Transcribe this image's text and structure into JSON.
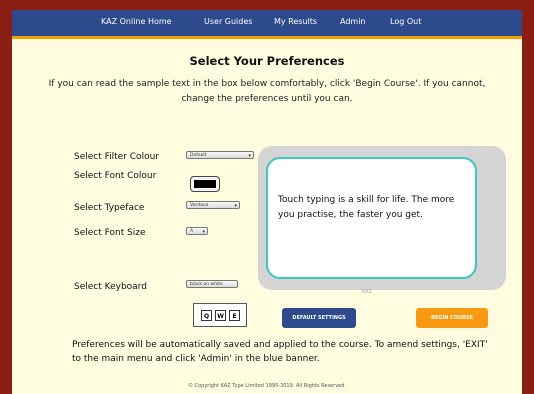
{
  "nav": {
    "items": [
      "KAZ Online Home",
      "User Guides",
      "My Results",
      "Admin",
      "Log Out"
    ]
  },
  "title": "Select Your Preferences",
  "intro": "If you can read the sample text in the box below comfortably, click 'Begin Course'. If you cannot, change the preferences until you can.",
  "labels": {
    "filter_colour": "Select Filter Colour",
    "font_colour": "Select Font Colour",
    "typeface": "Select Typeface",
    "font_size": "Select Font Size",
    "keyboard": "Select Keyboard"
  },
  "controls": {
    "filter_colour_value": "Default",
    "font_colour_value": "#000000",
    "typeface_value": "Verdana",
    "font_size_value": "A",
    "keyboard_value": "black on white"
  },
  "keyboard_keys": [
    "Q",
    "W",
    "E"
  ],
  "preview": {
    "text": "Touch typing is a skill for life. The more you practise, the faster you get.",
    "brand": "KAZ"
  },
  "buttons": {
    "default_settings": "DEFAULT SETTINGS",
    "begin_course": "BEGIN COURSE"
  },
  "footer_note": "Preferences will be automatically saved and applied to the course. To amend settings, 'EXIT' to the main menu and click 'Admin' in the blue banner.",
  "copyright": "© Copyright KAZ Type Limited 1995-2019. All Rights Reserved.",
  "colors": {
    "banner": "#2c4a8c",
    "accent": "#f0a000",
    "background": "#fffce0",
    "frame": "#8b1e14",
    "preview_border": "#3cc6c0"
  }
}
